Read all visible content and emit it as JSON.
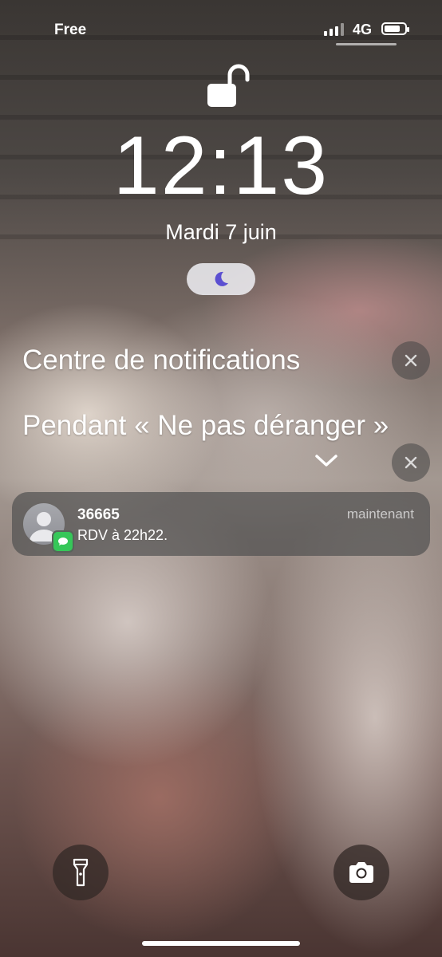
{
  "status_bar": {
    "carrier": "Free",
    "network": "4G",
    "signal_bars_active": 3,
    "battery_level_percent": 80
  },
  "lock_screen": {
    "lock_icon": "unlocked-padlock-icon",
    "time": "12:13",
    "date": "Mardi 7 juin",
    "focus_icon": "moon-icon"
  },
  "notification_center": {
    "title": "Centre de notifications",
    "dnd_section_title": "Pendant « Ne pas déranger »",
    "close_icon": "close-icon",
    "expand_icon": "chevron-down-icon"
  },
  "notification": {
    "sender": "36665",
    "body": "RDV à 22h22.",
    "time": "maintenant",
    "app_icon": "messages-icon",
    "accent": "#36c759"
  },
  "bottom_controls": {
    "left": "flashlight-icon",
    "right": "camera-icon"
  }
}
